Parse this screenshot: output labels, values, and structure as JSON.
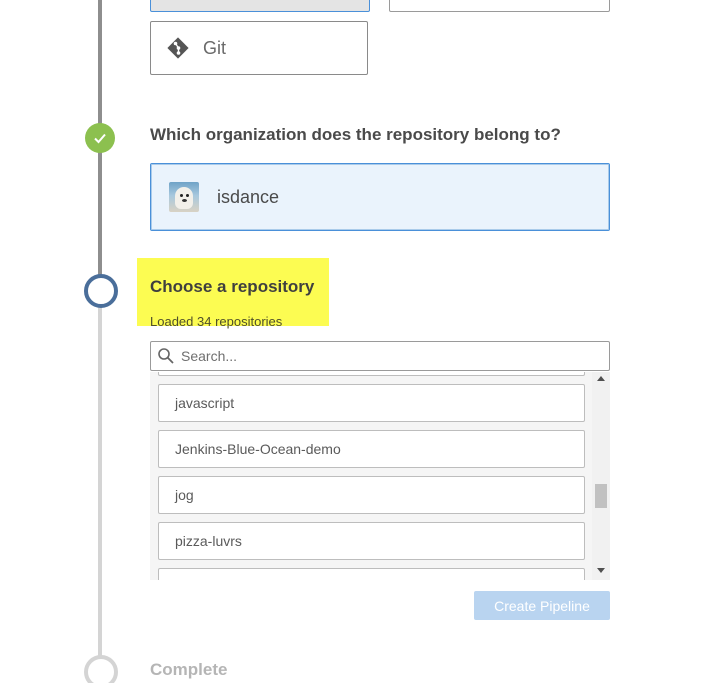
{
  "providers": {
    "git_label": "Git"
  },
  "organization_step": {
    "heading": "Which organization does the repository belong to?",
    "selected_org": "isdance"
  },
  "repository_step": {
    "heading": "Choose a repository",
    "status": "Loaded 34 repositories",
    "search_placeholder": "Search...",
    "repositories": [
      "javascript",
      "Jenkins-Blue-Ocean-demo",
      "jog",
      "pizza-luvrs"
    ],
    "create_button": "Create Pipeline"
  },
  "complete_step": {
    "label": "Complete"
  },
  "colors": {
    "step_done": "#8cc04f",
    "step_current": "#4a6e9a",
    "highlight": "#fcfc52",
    "selected_border": "#4a90d9",
    "create_button_bg": "#b9d4f0"
  }
}
